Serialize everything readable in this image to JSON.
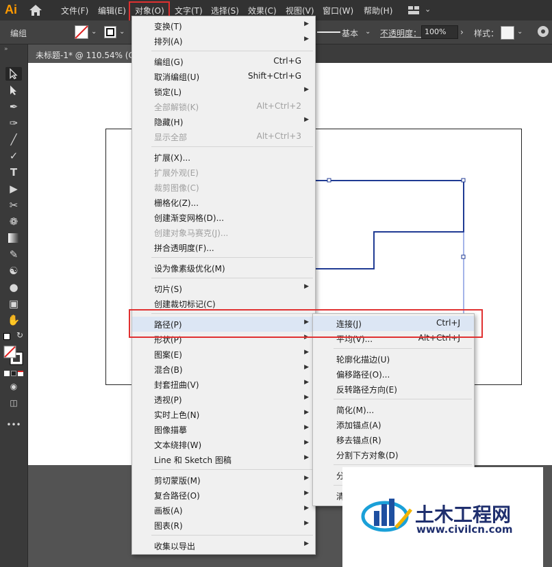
{
  "app": {
    "logo": "Ai"
  },
  "menubar": {
    "items": [
      "文件(F)",
      "编辑(E)",
      "对象(O)",
      "文字(T)",
      "选择(S)",
      "效果(C)",
      "视图(V)",
      "窗口(W)",
      "帮助(H)"
    ]
  },
  "control_bar": {
    "group_label": "编组",
    "stroke_style": "基本",
    "opacity_label": "不透明度：",
    "opacity_value": "100%",
    "style_label": "样式："
  },
  "document": {
    "tab_title": "未标题-1* @ 110.54% (C"
  },
  "object_menu": {
    "items": [
      {
        "label": "变换(T)",
        "shortcut": "",
        "submenu": true,
        "disabled": false
      },
      {
        "label": "排列(A)",
        "shortcut": "",
        "submenu": true,
        "disabled": false
      },
      {
        "label": "编组(G)",
        "shortcut": "Ctrl+G",
        "submenu": false,
        "disabled": false
      },
      {
        "label": "取消编组(U)",
        "shortcut": "Shift+Ctrl+G",
        "submenu": false,
        "disabled": false
      },
      {
        "label": "锁定(L)",
        "shortcut": "",
        "submenu": true,
        "disabled": false
      },
      {
        "label": "全部解锁(K)",
        "shortcut": "Alt+Ctrl+2",
        "submenu": false,
        "disabled": true
      },
      {
        "label": "隐藏(H)",
        "shortcut": "",
        "submenu": true,
        "disabled": false
      },
      {
        "label": "显示全部",
        "shortcut": "Alt+Ctrl+3",
        "submenu": false,
        "disabled": true
      },
      {
        "label": "扩展(X)...",
        "shortcut": "",
        "submenu": false,
        "disabled": false
      },
      {
        "label": "扩展外观(E)",
        "shortcut": "",
        "submenu": false,
        "disabled": true
      },
      {
        "label": "裁剪图像(C)",
        "shortcut": "",
        "submenu": false,
        "disabled": true
      },
      {
        "label": "栅格化(Z)...",
        "shortcut": "",
        "submenu": false,
        "disabled": false
      },
      {
        "label": "创建渐变网格(D)...",
        "shortcut": "",
        "submenu": false,
        "disabled": false
      },
      {
        "label": "创建对象马赛克(J)...",
        "shortcut": "",
        "submenu": false,
        "disabled": true
      },
      {
        "label": "拼合透明度(F)...",
        "shortcut": "",
        "submenu": false,
        "disabled": false
      },
      {
        "label": "设为像素级优化(M)",
        "shortcut": "",
        "submenu": false,
        "disabled": false
      },
      {
        "label": "切片(S)",
        "shortcut": "",
        "submenu": true,
        "disabled": false
      },
      {
        "label": "创建裁切标记(C)",
        "shortcut": "",
        "submenu": false,
        "disabled": false
      },
      {
        "label": "路径(P)",
        "shortcut": "",
        "submenu": true,
        "disabled": false,
        "highlighted": true
      },
      {
        "label": "形状(P)",
        "shortcut": "",
        "submenu": true,
        "disabled": false
      },
      {
        "label": "图案(E)",
        "shortcut": "",
        "submenu": true,
        "disabled": false
      },
      {
        "label": "混合(B)",
        "shortcut": "",
        "submenu": true,
        "disabled": false
      },
      {
        "label": "封套扭曲(V)",
        "shortcut": "",
        "submenu": true,
        "disabled": false
      },
      {
        "label": "透视(P)",
        "shortcut": "",
        "submenu": true,
        "disabled": false
      },
      {
        "label": "实时上色(N)",
        "shortcut": "",
        "submenu": true,
        "disabled": false
      },
      {
        "label": "图像描摹",
        "shortcut": "",
        "submenu": true,
        "disabled": false
      },
      {
        "label": "文本绕排(W)",
        "shortcut": "",
        "submenu": true,
        "disabled": false
      },
      {
        "label": "Line 和 Sketch 图稿",
        "shortcut": "",
        "submenu": true,
        "disabled": false
      },
      {
        "label": "剪切蒙版(M)",
        "shortcut": "",
        "submenu": true,
        "disabled": false
      },
      {
        "label": "复合路径(O)",
        "shortcut": "",
        "submenu": true,
        "disabled": false
      },
      {
        "label": "画板(A)",
        "shortcut": "",
        "submenu": true,
        "disabled": false
      },
      {
        "label": "图表(R)",
        "shortcut": "",
        "submenu": true,
        "disabled": false
      },
      {
        "label": "收集以导出",
        "shortcut": "",
        "submenu": true,
        "disabled": false
      }
    ]
  },
  "path_submenu": {
    "items": [
      {
        "label": "连接(J)",
        "shortcut": "Ctrl+J",
        "highlighted": true
      },
      {
        "label": "平均(V)...",
        "shortcut": "Alt+Ctrl+J"
      },
      {
        "label": "轮廓化描边(U)",
        "shortcut": ""
      },
      {
        "label": "偏移路径(O)...",
        "shortcut": ""
      },
      {
        "label": "反转路径方向(E)",
        "shortcut": ""
      },
      {
        "label": "简化(M)...",
        "shortcut": ""
      },
      {
        "label": "添加锚点(A)",
        "shortcut": ""
      },
      {
        "label": "移去锚点(R)",
        "shortcut": ""
      },
      {
        "label": "分割下方对象(D)",
        "shortcut": ""
      },
      {
        "label": "分",
        "shortcut": ""
      },
      {
        "label": "清",
        "shortcut": ""
      }
    ]
  },
  "watermark": {
    "brand": "土木工程网",
    "url": "www.civilcn.com"
  },
  "colors": {
    "highlight_box": "#e03030",
    "path_stroke": "#1f3a93",
    "menu_bg": "#f0f0f0"
  }
}
